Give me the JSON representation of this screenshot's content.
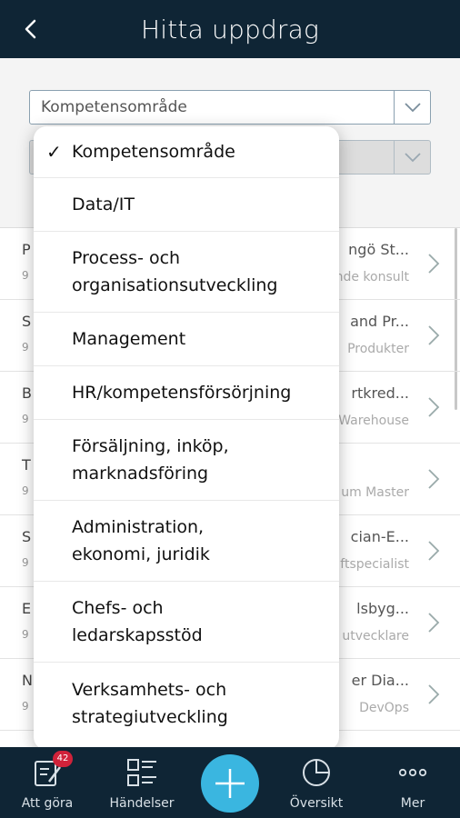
{
  "header": {
    "title": "Hitta uppdrag"
  },
  "filters": {
    "select1_value": "Kompetensområde",
    "select2_value": ""
  },
  "list": {
    "rows": [
      {
        "left_title": "P",
        "left_sub": "9",
        "right_title": "ngö St...",
        "right_sub": "nde konsult"
      },
      {
        "left_title": "S",
        "left_sub": "9",
        "right_title": "and Pr...",
        "right_sub": "Produkter"
      },
      {
        "left_title": "B",
        "left_sub": "9",
        "right_title": "rtkred...",
        "right_sub": "Warehouse"
      },
      {
        "left_title": "T",
        "left_sub": "9",
        "right_title": "",
        "right_sub": "um Master"
      },
      {
        "left_title": "S",
        "left_sub": "9",
        "right_title": "cian-E...",
        "right_sub": "ftspecialist"
      },
      {
        "left_title": "E",
        "left_sub": "9",
        "right_title": "lsbyg...",
        "right_sub": "utvecklare"
      },
      {
        "left_title": "N",
        "left_sub": "9",
        "right_title": "er Dia...",
        "right_sub": "DevOps"
      }
    ]
  },
  "dropdown": {
    "options": [
      {
        "label": "Kompetensområde",
        "selected": true,
        "check": "✓"
      },
      {
        "label": "Data/IT"
      },
      {
        "label": "Process- och organisationsutveckling"
      },
      {
        "label": "Management"
      },
      {
        "label": "HR/kompetensförsörjning"
      },
      {
        "label": "Försäljning, inköp, marknadsföring"
      },
      {
        "label": "Administration, ekonomi, juridik"
      },
      {
        "label": "Chefs- och ledarskapsstöd"
      },
      {
        "label": "Verksamhets- och strategiutveckling"
      }
    ]
  },
  "tabbar": {
    "todo_label": "Att göra",
    "todo_badge": "42",
    "events_label": "Händelser",
    "overview_label": "Översikt",
    "more_label": "Mer"
  },
  "colors": {
    "header": "#0f2535",
    "accent": "#3ab6e0",
    "badge": "#d0223a"
  }
}
